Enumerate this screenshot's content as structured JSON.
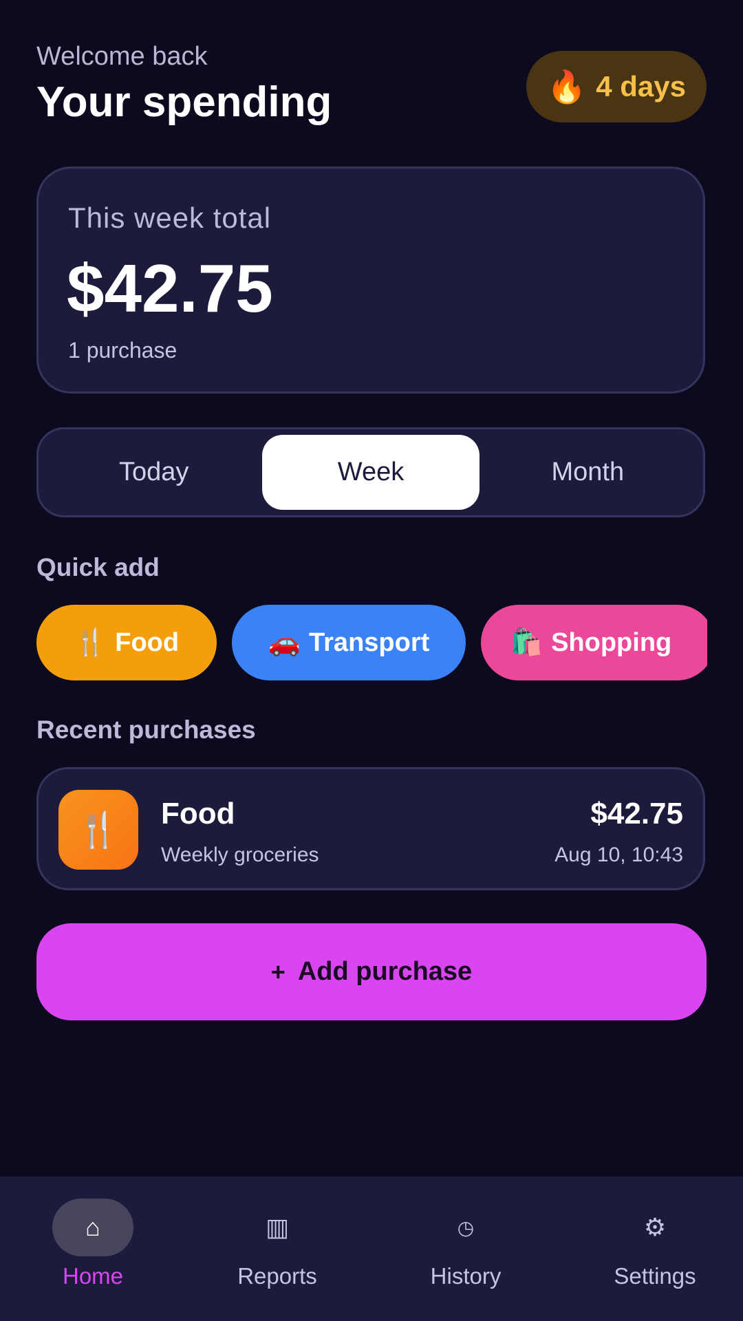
{
  "header": {
    "welcome": "Welcome back",
    "title": "Your spending",
    "streak_icon": "🔥",
    "streak_text": "4 days"
  },
  "summary": {
    "label": "This week total",
    "amount": "$42.75",
    "count": "1 purchase"
  },
  "period_tabs": [
    {
      "label": "Today",
      "active": false
    },
    {
      "label": "Week",
      "active": true
    },
    {
      "label": "Month",
      "active": false
    }
  ],
  "quick_add": {
    "label": "Quick add",
    "chips": [
      {
        "icon": "🍴",
        "label": "Food",
        "color": "#f59e0b"
      },
      {
        "icon": "🚗",
        "label": "Transport",
        "color": "#3b82f6"
      },
      {
        "icon": "🛍️",
        "label": "Shopping",
        "color": "#ec4899"
      }
    ]
  },
  "recent": {
    "label": "Recent purchases",
    "items": [
      {
        "icon": "🍴",
        "category": "Food",
        "note": "Weekly groceries",
        "amount": "$42.75",
        "date": "Aug 10, 10:43"
      }
    ]
  },
  "add_button": {
    "plus": "+",
    "label": "Add purchase"
  },
  "nav": [
    {
      "icon": "⌂",
      "label": "Home",
      "active": true
    },
    {
      "icon": "▥",
      "label": "Reports",
      "active": false
    },
    {
      "icon": "◷",
      "label": "History",
      "active": false
    },
    {
      "icon": "⚙",
      "label": "Settings",
      "active": false
    }
  ],
  "colors": {
    "accent": "#d946ef",
    "background": "#0b0a1f",
    "card": "#1d1b3b"
  }
}
